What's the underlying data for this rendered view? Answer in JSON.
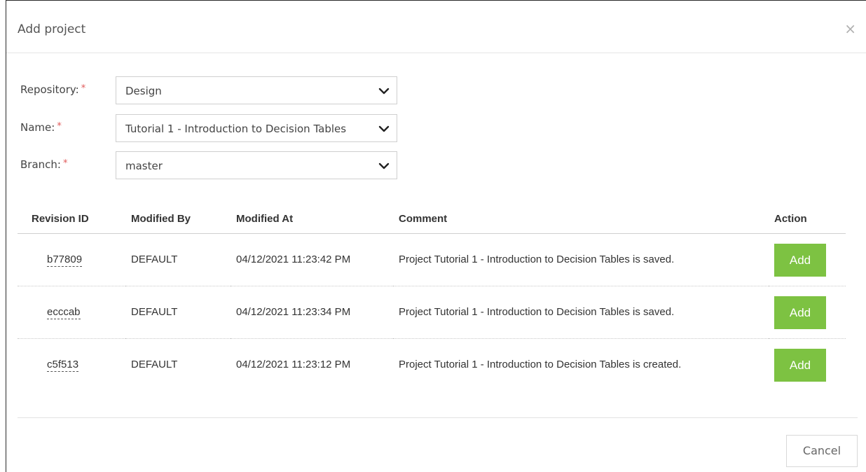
{
  "dialog": {
    "title": "Add project",
    "close_glyph": "×"
  },
  "form": {
    "repository": {
      "label": "Repository:",
      "required_mark": "*",
      "value": "Design"
    },
    "name": {
      "label": "Name:",
      "required_mark": "*",
      "value": "Tutorial 1 - Introduction to Decision Tables"
    },
    "branch": {
      "label": "Branch:",
      "required_mark": "*",
      "value": "master"
    }
  },
  "table": {
    "headers": [
      "Revision ID",
      "Modified By",
      "Modified At",
      "Comment",
      "Action"
    ],
    "rows": [
      {
        "revision_id": "b77809",
        "modified_by": "DEFAULT",
        "modified_at": "04/12/2021 11:23:42 PM",
        "comment": "Project Tutorial 1 - Introduction to Decision Tables is saved.",
        "action": "Add"
      },
      {
        "revision_id": "ecccab",
        "modified_by": "DEFAULT",
        "modified_at": "04/12/2021 11:23:34 PM",
        "comment": "Project Tutorial 1 - Introduction to Decision Tables is saved.",
        "action": "Add"
      },
      {
        "revision_id": "c5f513",
        "modified_by": "DEFAULT",
        "modified_at": "04/12/2021 11:23:12 PM",
        "comment": "Project Tutorial 1 - Introduction to Decision Tables is created.",
        "action": "Add"
      }
    ]
  },
  "footer": {
    "cancel_label": "Cancel"
  },
  "colors": {
    "add_button": "#7dc242",
    "required": "#e05a5a"
  }
}
